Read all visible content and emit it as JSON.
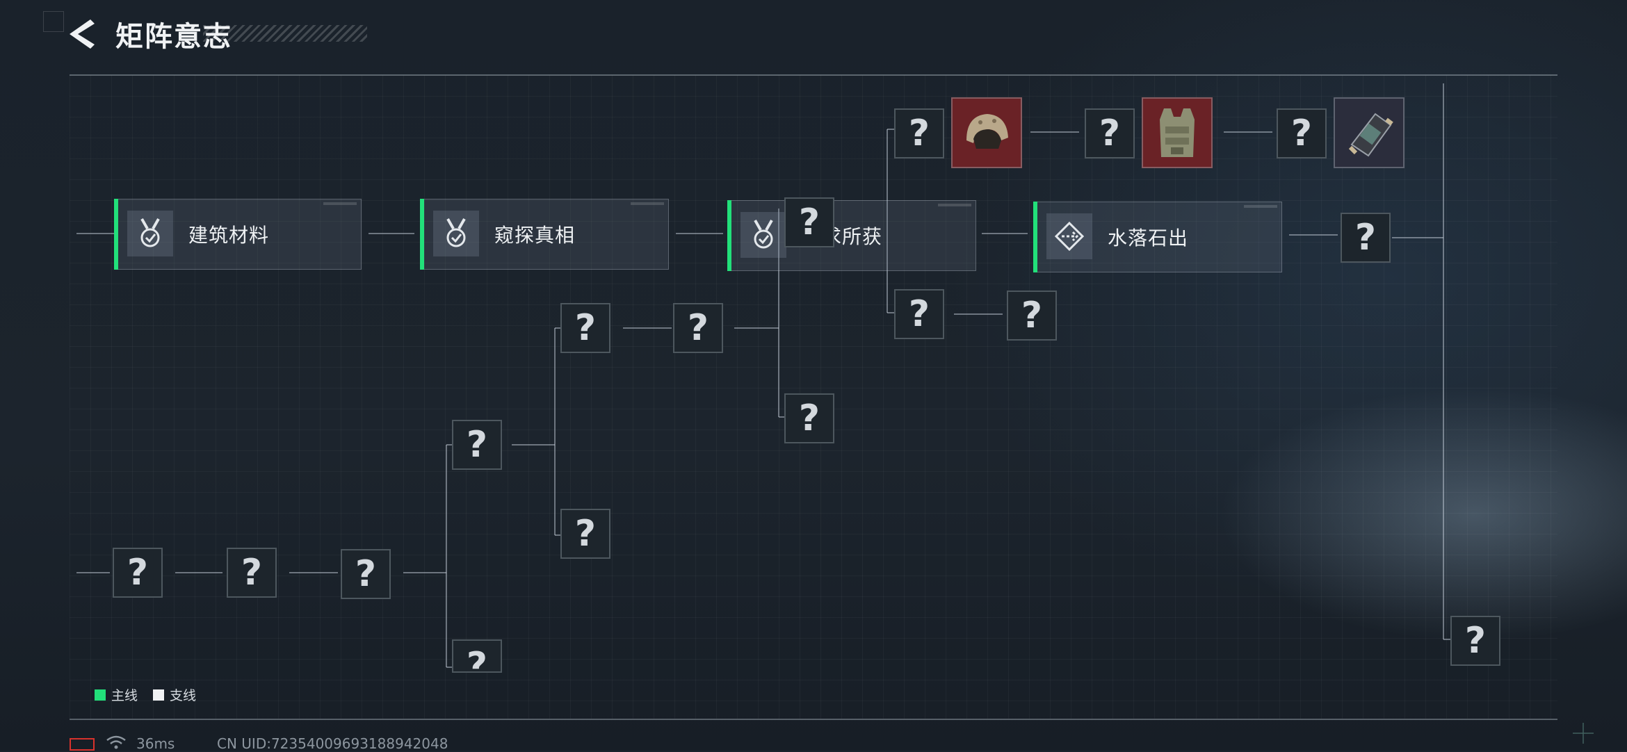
{
  "header": {
    "title": "矩阵意志"
  },
  "main_quests": [
    {
      "label": "建筑材料",
      "status": "completed",
      "icon": "medal-check-icon"
    },
    {
      "label": "窥探真相",
      "status": "completed",
      "icon": "medal-check-icon"
    },
    {
      "label": "所求所获",
      "status": "completed",
      "icon": "medal-check-icon"
    },
    {
      "label": "水落石出",
      "status": "active",
      "icon": "diamond-arrow-icon"
    }
  ],
  "unknown_symbol": "?",
  "rewards": [
    {
      "name": "helmet",
      "icon": "helmet-icon",
      "bg": "#6a2226"
    },
    {
      "name": "vest",
      "icon": "armor-vest-icon",
      "bg": "#6a2226"
    },
    {
      "name": "rig",
      "icon": "gear-rig-icon",
      "bg": "#2b2d3c"
    }
  ],
  "legend": {
    "main": {
      "label": "主线",
      "color": "#22e07a"
    },
    "side": {
      "label": "支线",
      "color": "#f0f2f4"
    }
  },
  "status_bar": {
    "ping": "36ms",
    "uid": "CN UID:72354009693188942048"
  },
  "colors": {
    "accent": "#22e07a",
    "background": "#1b232c"
  }
}
